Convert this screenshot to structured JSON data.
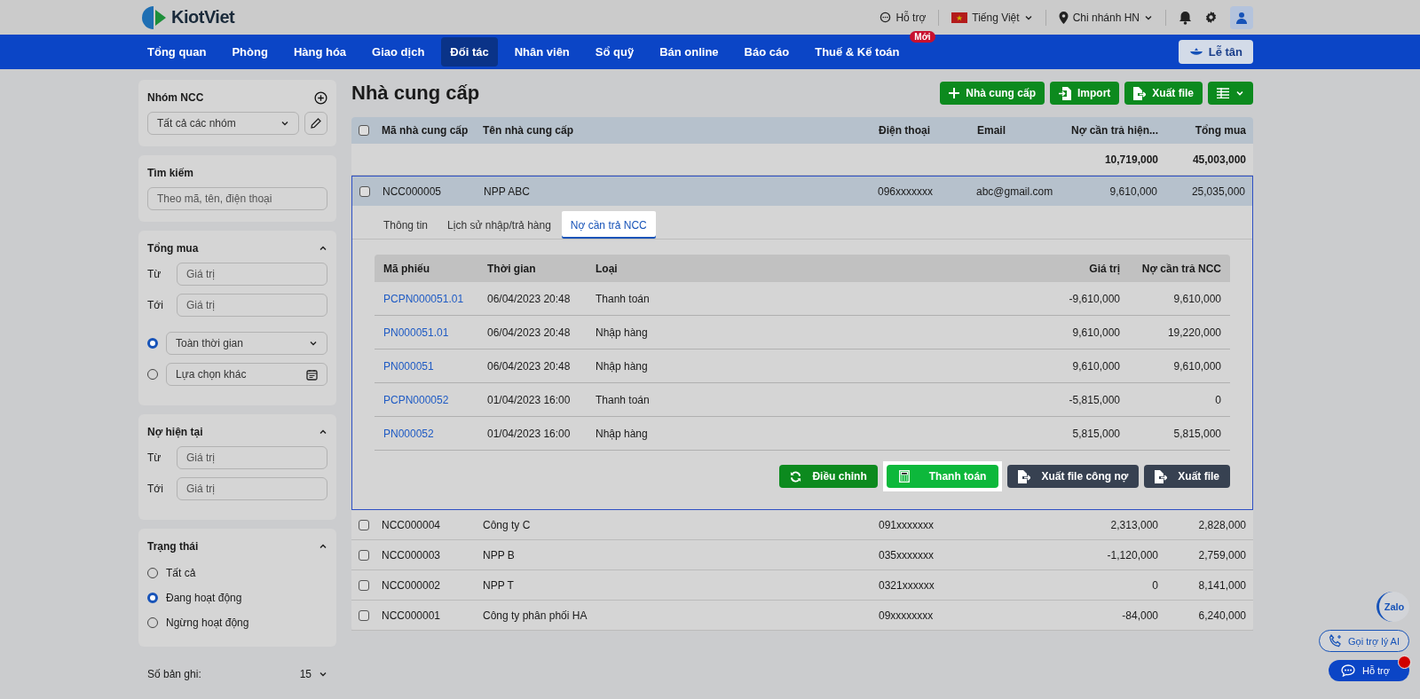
{
  "header": {
    "logo": "KiotViet",
    "support": "Hỗ trợ",
    "language": "Tiếng Việt",
    "branch": "Chi nhánh HN"
  },
  "nav": {
    "items": [
      {
        "label": "Tổng quan",
        "selected": false
      },
      {
        "label": "Phòng",
        "selected": false
      },
      {
        "label": "Hàng hóa",
        "selected": false
      },
      {
        "label": "Giao dịch",
        "selected": false
      },
      {
        "label": "Đối tác",
        "selected": true
      },
      {
        "label": "Nhân viên",
        "selected": false
      },
      {
        "label": "Sổ quỹ",
        "selected": false
      },
      {
        "label": "Bán online",
        "selected": false
      },
      {
        "label": "Báo cáo",
        "selected": false
      },
      {
        "label": "Thuế & Kế toán",
        "selected": false,
        "badge": "Mới"
      }
    ],
    "reception": "Lễ tân"
  },
  "sidebar": {
    "group": {
      "title": "Nhóm NCC",
      "value": "Tất cả các nhóm"
    },
    "search": {
      "title": "Tìm kiếm",
      "placeholder": "Theo mã, tên, điện thoại"
    },
    "total_purchase": {
      "title": "Tổng mua",
      "from_label": "Từ",
      "from_placeholder": "Giá trị",
      "to_label": "Tới",
      "to_placeholder": "Giá trị",
      "time_options": [
        {
          "label": "Toàn thời gian",
          "kind": "dropdown",
          "selected": true
        },
        {
          "label": "Lựa chọn khác",
          "kind": "calendar",
          "selected": false
        }
      ]
    },
    "current_debt": {
      "title": "Nợ hiện tại",
      "from_label": "Từ",
      "from_placeholder": "Giá trị",
      "to_label": "Tới",
      "to_placeholder": "Giá trị"
    },
    "status": {
      "title": "Trạng thái",
      "options": [
        {
          "label": "Tất cả",
          "selected": false
        },
        {
          "label": "Đang hoạt động",
          "selected": true
        },
        {
          "label": "Ngừng hoạt động",
          "selected": false
        }
      ]
    },
    "records": {
      "label": "Số bản ghi:",
      "value": "15"
    }
  },
  "main": {
    "title": "Nhà cung cấp",
    "actions": [
      {
        "label": "Nhà cung cấp",
        "kind": "add"
      },
      {
        "label": "Import",
        "kind": "import"
      },
      {
        "label": "Xuất file",
        "kind": "export"
      }
    ],
    "table": {
      "columns": [
        "Mã nhà cung cấp",
        "Tên nhà cung cấp",
        "Điện thoại",
        "Email",
        "Nợ cần trả hiện...",
        "Tổng mua"
      ],
      "header_checked": false,
      "summary": {
        "debt": "10,719,000",
        "total": "45,003,000"
      },
      "rows": [
        {
          "code": "NCC000005",
          "name": "NPP ABC",
          "phone": "096xxxxxxx",
          "email": "abc@gmail.com",
          "debt": "9,610,000",
          "total": "25,035,000",
          "checked": false,
          "expanded": true
        },
        {
          "code": "NCC000004",
          "name": "Công ty C",
          "phone": "091xxxxxxx",
          "debt": "2,313,000",
          "total": "2,828,000",
          "checked": false,
          "expanded": false
        },
        {
          "code": "NCC000003",
          "name": "NPP B",
          "phone": "035xxxxxxx",
          "debt": "-1,120,000",
          "total": "2,759,000",
          "checked": false,
          "expanded": false
        },
        {
          "code": "NCC000002",
          "name": "NPP T",
          "phone": "0321xxxxxx",
          "debt": "0",
          "total": "8,141,000",
          "checked": false,
          "expanded": false
        },
        {
          "code": "NCC000001",
          "name": "Công ty phân phối HA",
          "phone": "09xxxxxxxx",
          "debt": "-84,000",
          "total": "6,240,000",
          "checked": false,
          "expanded": false
        }
      ]
    },
    "detail": {
      "tabs": [
        {
          "label": "Thông tin",
          "selected": false,
          "highlighted": false
        },
        {
          "label": "Lịch sử nhập/trả hàng",
          "selected": false,
          "highlighted": false
        },
        {
          "label": "Nợ cần trả NCC",
          "selected": true,
          "highlighted": true
        }
      ],
      "columns": [
        "Mã phiếu",
        "Thời gian",
        "Loại",
        "Giá trị",
        "Nợ cần trả NCC"
      ],
      "rows": [
        {
          "code": "PCPN000051.01",
          "time": "06/04/2023 20:48",
          "type": "Thanh toán",
          "value": "-9,610,000",
          "debt": "9,610,000"
        },
        {
          "code": "PN000051.01",
          "time": "06/04/2023 20:48",
          "type": "Nhập hàng",
          "value": "9,610,000",
          "debt": "19,220,000"
        },
        {
          "code": "PN000051",
          "time": "06/04/2023 20:48",
          "type": "Nhập hàng",
          "value": "9,610,000",
          "debt": "9,610,000"
        },
        {
          "code": "PCPN000052",
          "time": "01/04/2023 16:00",
          "type": "Thanh toán",
          "value": "-5,815,000",
          "debt": "0"
        },
        {
          "code": "PN000052",
          "time": "01/04/2023 16:00",
          "type": "Nhập hàng",
          "value": "5,815,000",
          "debt": "5,815,000"
        }
      ],
      "buttons": [
        {
          "label": "Điều chỉnh",
          "kind": "adjust",
          "highlighted": false
        },
        {
          "label": "Thanh toán",
          "kind": "pay",
          "highlighted": true
        },
        {
          "label": "Xuất file công nợ",
          "kind": "export",
          "highlighted": false
        },
        {
          "label": "Xuất file",
          "kind": "export",
          "highlighted": false
        }
      ]
    }
  },
  "floating": {
    "zalo": "Zalo",
    "ai": "Gọi trợ lý AI",
    "help": "Hỗ trợ",
    "help_notification": true
  }
}
